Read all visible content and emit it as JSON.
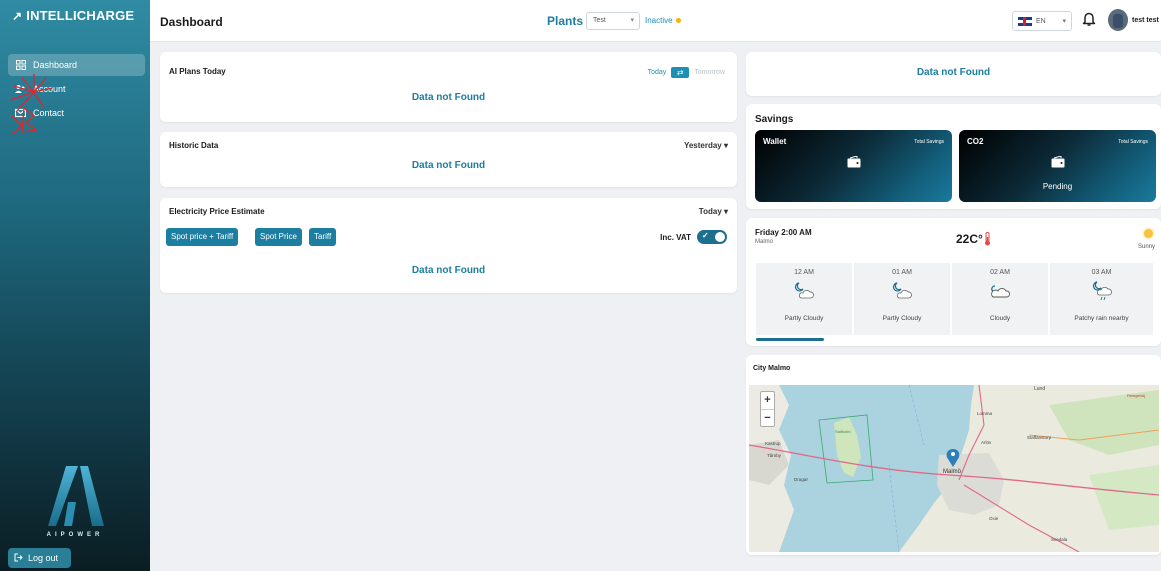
{
  "sidebar": {
    "brand": "INTELLICHARGE",
    "items": [
      {
        "label": "Dashboard",
        "icon": "grid-icon"
      },
      {
        "label": "Account",
        "icon": "users-icon"
      },
      {
        "label": "Contact",
        "icon": "contact-icon"
      }
    ],
    "logo_text": "AIPOWER",
    "logout_label": "Log out"
  },
  "header": {
    "title": "Dashboard",
    "plants_label": "Plants",
    "plant_selected": "Test",
    "plant_status": "Inactive",
    "language": "EN",
    "user_name": "test test"
  },
  "ai_plans": {
    "title": "AI Plans Today",
    "today": "Today",
    "tomorrow": "Tomorrow",
    "empty": "Data not Found"
  },
  "historic": {
    "title": "Historic Data",
    "period": "Yesterday ▾",
    "empty": "Data not Found"
  },
  "electricity": {
    "title": "Electricity Price Estimate",
    "period": "Today ▾",
    "chips": [
      "Spot price + Tariff",
      "Spot Price",
      "Tariff"
    ],
    "vat_label": "Inc. VAT",
    "empty": "Data not Found"
  },
  "right_top": {
    "empty": "Data not Found"
  },
  "savings": {
    "title": "Savings",
    "boxes": [
      {
        "name": "Wallet",
        "total_label": "Total Savings",
        "value": ""
      },
      {
        "name": "CO2",
        "total_label": "Total Savings",
        "value": "Pending"
      }
    ]
  },
  "weather": {
    "time": "Friday 2:00 AM",
    "city": "Malmo",
    "temperature": "22C°",
    "condition": "Sunny",
    "hours": [
      {
        "time": "12 AM",
        "desc": "Partly Cloudy"
      },
      {
        "time": "01 AM",
        "desc": "Partly Cloudy"
      },
      {
        "time": "02 AM",
        "desc": "Cloudy"
      },
      {
        "time": "03 AM",
        "desc": "Patchy rain nearby"
      }
    ]
  },
  "map": {
    "title": "City Malmo",
    "zoom_in": "+",
    "zoom_out": "−",
    "labels": [
      "Lund",
      "Lomma",
      "Arlöv",
      "Staffanstorp",
      "Malmö",
      "Kastrup",
      "Tårnby",
      "Dragør",
      "Oxie",
      "Svedala",
      "Saltholm",
      "Reingehöj"
    ]
  }
}
